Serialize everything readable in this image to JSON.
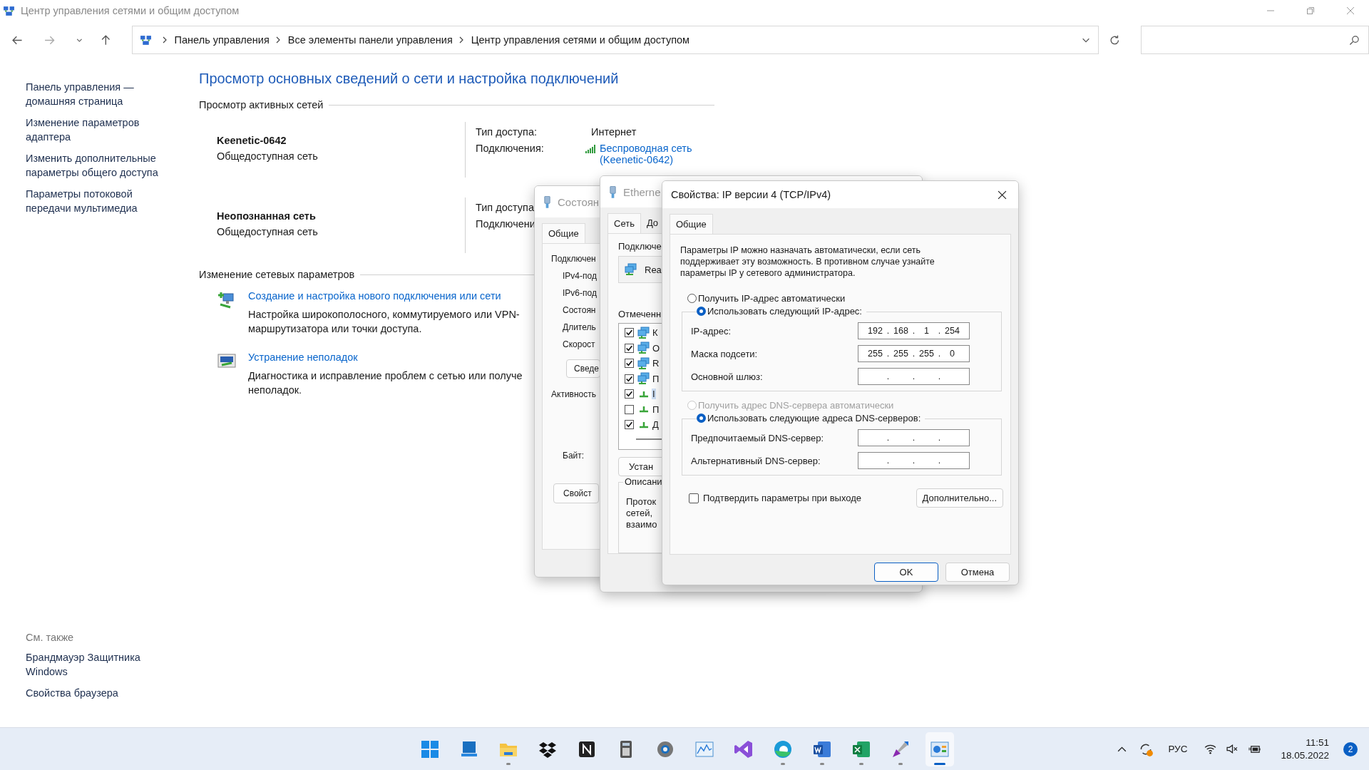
{
  "window": {
    "title": "Центр управления сетями и общим доступом"
  },
  "address_bar": {
    "breadcrumbs": [
      "Панель управления",
      "Все элементы панели управления",
      "Центр управления сетями и общим доступом"
    ]
  },
  "sidebar": {
    "links": [
      "Панель управления — домашняя страница",
      "Изменение параметров адаптера",
      "Изменить дополнительные параметры общего доступа",
      "Параметры потоковой передачи мультимедиа"
    ],
    "see_also_title": "См. также",
    "see_also": [
      "Брандмауэр Защитника Windows",
      "Свойства браузера"
    ]
  },
  "content": {
    "heading": "Просмотр основных сведений о сети и настройка подключений",
    "active_networks_title": "Просмотр активных сетей",
    "networks": [
      {
        "name": "Keenetic-0642",
        "category": "Общедоступная сеть",
        "details": [
          {
            "label": "Тип доступа:",
            "value": "Интернет",
            "kind": "text"
          },
          {
            "label": "Подключения:",
            "value": "Беспроводная сеть (Keenetic-0642)",
            "kind": "wifi-link"
          }
        ]
      },
      {
        "name": "Неопознанная сеть",
        "category": "Общедоступная сеть",
        "details": [
          {
            "label": "Тип доступа"
          },
          {
            "label": "Подключени"
          }
        ]
      }
    ],
    "change_title": "Изменение сетевых параметров",
    "tasks": [
      {
        "kind": "new-connection",
        "link": "Создание и настройка нового подключения или сети",
        "lines": [
          "Настройка широкополосного, коммутируемого или VPN-",
          "маршрутизатора или точки доступа."
        ]
      },
      {
        "kind": "troubleshoot",
        "link": "Устранение неполадок",
        "lines": [
          "Диагностика и исправление проблем с сетью или получе",
          "неполадок."
        ]
      }
    ]
  },
  "status_dialog": {
    "title": "Состоян",
    "tab": "Общие",
    "section": "Подключен",
    "rows": [
      "IPv4-под",
      "IPv6-под",
      "Состоян",
      "Длитель",
      "Скорост"
    ],
    "details_button": "Сведе",
    "activity": "Активность",
    "bytes": "Байт:",
    "properties_button": "Свойст"
  },
  "ethernet_dialog": {
    "title": "Etherne",
    "tabs": [
      {
        "label": "Сеть",
        "selected": true
      },
      {
        "label": "До",
        "selected": false
      }
    ],
    "connect_label": "Подключе",
    "adapter": "Rea",
    "components_label": "Отмеченн",
    "components": [
      {
        "label": "К",
        "kind": "service",
        "checked": true,
        "selected": false
      },
      {
        "label": "О",
        "kind": "service",
        "checked": true,
        "selected": false
      },
      {
        "label": "R",
        "kind": "service",
        "checked": true,
        "selected": false
      },
      {
        "label": "П",
        "kind": "service",
        "checked": true,
        "selected": false
      },
      {
        "label": "I",
        "kind": "protocol",
        "checked": true,
        "selected": true
      },
      {
        "label": "П",
        "kind": "protocol",
        "checked": false,
        "selected": false
      },
      {
        "label": "Д",
        "kind": "protocol",
        "checked": true,
        "selected": false
      }
    ],
    "install_button": "Устан",
    "description_title": "Описани",
    "description_lines": [
      "Проток",
      "сетей,",
      "взаимо"
    ]
  },
  "ip_dialog": {
    "title": "Свойства: IP версии 4 (TCP/IPv4)",
    "tab": "Общие",
    "intro": "Параметры IP можно назначать автоматически, если сеть поддерживает эту возможность. В противном случае узнайте параметры IP у сетевого администратора.",
    "octet_separator": ".",
    "ip_mode": [
      {
        "label": "Получить IP-адрес автоматически",
        "selected": false,
        "disabled": false
      },
      {
        "label": "Использовать следующий IP-адрес:",
        "selected": true,
        "disabled": false
      }
    ],
    "ip_fields": [
      {
        "label": "IP-адрес:",
        "octets": [
          "192",
          "168",
          "1",
          "254"
        ]
      },
      {
        "label": "Маска подсети:",
        "octets": [
          "255",
          "255",
          "255",
          "0"
        ]
      },
      {
        "label": "Основной шлюз:"
      }
    ],
    "dns_mode": [
      {
        "label": "Получить адрес DNS-сервера автоматически",
        "selected": false,
        "disabled": true
      },
      {
        "label": "Использовать следующие адреса DNS-серверов:",
        "selected": true,
        "disabled": false
      }
    ],
    "dns_fields": [
      {
        "label": "Предпочитаемый DNS-сервер:"
      },
      {
        "label": "Альтернативный DNS-сервер:"
      }
    ],
    "validate": {
      "label": "Подтвердить параметры при выходе",
      "checked": false
    },
    "advanced_button": "Дополнительно...",
    "ok_button": "OK",
    "cancel_button": "Отмена"
  },
  "taskbar": {
    "apps": [
      {
        "kind": "start",
        "running": false,
        "active": false
      },
      {
        "kind": "widgets",
        "running": false,
        "active": false
      },
      {
        "kind": "explorer",
        "running": true,
        "active": false
      },
      {
        "kind": "dropbox",
        "running": false,
        "active": false
      },
      {
        "kind": "notion",
        "running": false,
        "active": false
      },
      {
        "kind": "calculator",
        "running": false,
        "active": false
      },
      {
        "kind": "settings",
        "running": false,
        "active": false
      },
      {
        "kind": "monitor",
        "running": false,
        "active": false
      },
      {
        "kind": "vs",
        "running": false,
        "active": false
      },
      {
        "kind": "edge",
        "running": true,
        "active": false
      },
      {
        "kind": "word",
        "running": true,
        "active": false
      },
      {
        "kind": "excel",
        "running": true,
        "active": false
      },
      {
        "kind": "tool",
        "running": true,
        "active": false
      },
      {
        "kind": "control-panel",
        "running": true,
        "active": true
      }
    ],
    "language": "РУС",
    "time": "11:51",
    "date": "18.05.2022",
    "notifications": "2"
  }
}
